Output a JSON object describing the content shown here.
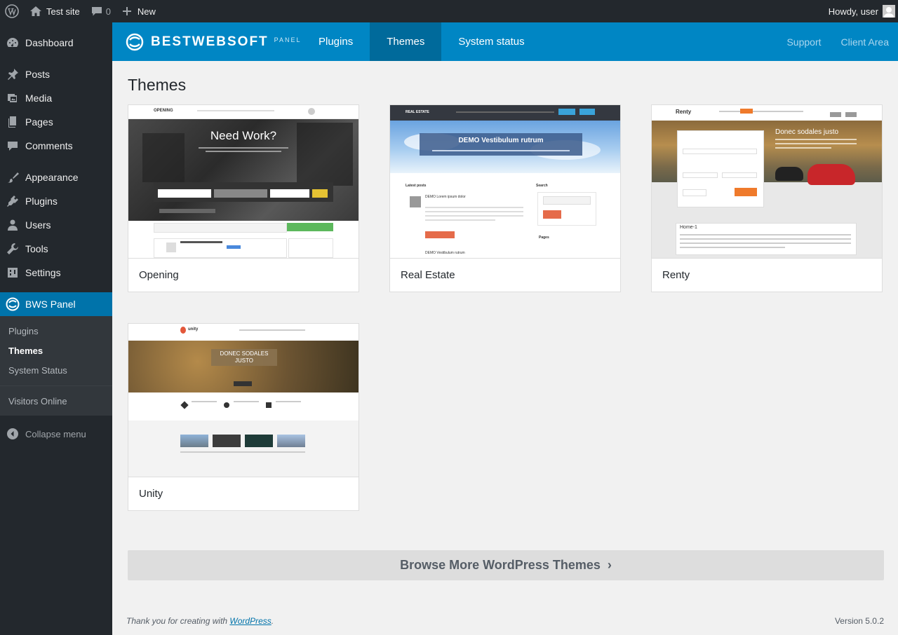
{
  "adminbar": {
    "site_name": "Test site",
    "comments_count": "0",
    "new_label": "New",
    "howdy": "Howdy, user"
  },
  "sidebar": {
    "items": [
      {
        "label": "Dashboard",
        "icon": "dashboard-icon"
      },
      {
        "label": "Posts",
        "icon": "pin-icon"
      },
      {
        "label": "Media",
        "icon": "media-icon"
      },
      {
        "label": "Pages",
        "icon": "pages-icon"
      },
      {
        "label": "Comments",
        "icon": "comments-icon"
      },
      {
        "label": "Appearance",
        "icon": "brush-icon"
      },
      {
        "label": "Plugins",
        "icon": "plugins-icon"
      },
      {
        "label": "Users",
        "icon": "users-icon"
      },
      {
        "label": "Tools",
        "icon": "tools-icon"
      },
      {
        "label": "Settings",
        "icon": "settings-icon"
      },
      {
        "label": "BWS Panel",
        "icon": "bws-icon"
      }
    ],
    "submenu": [
      "Plugins",
      "Themes",
      "System Status",
      "Visitors Online"
    ],
    "collapse": "Collapse menu"
  },
  "bws": {
    "logo": "BESTWEBSOFT",
    "logo_sub": "PANEL",
    "tabs": [
      "Plugins",
      "Themes",
      "System status"
    ],
    "links": [
      "Support",
      "Client Area"
    ]
  },
  "page": {
    "title": "Themes",
    "themes": [
      "Opening",
      "Real Estate",
      "Renty",
      "Unity"
    ],
    "browse": "Browse More WordPress Themes",
    "footer_text": "Thank you for creating with ",
    "footer_link": "WordPress",
    "footer_end": ".",
    "version": "Version 5.0.2"
  },
  "previews": {
    "opening": {
      "headline": "Need Work?",
      "logo": "OPENING"
    },
    "realestate": {
      "headline": "DEMO Vestibulum rutrum",
      "logo": "REAL ESTATE",
      "latest": "Latest posts",
      "search": "Search",
      "post1": "DEMO Lorem ipsum dolor",
      "post2": "DEMO Vestibulum rutrum",
      "pages": "Pages"
    },
    "renty": {
      "headline": "Donec sodales justo",
      "logo": "Renty",
      "section": "Home-1"
    },
    "unity": {
      "headline": "DONEC SODALES JUSTO",
      "logo": "unity"
    }
  },
  "colors": {
    "wp_dark": "#23282d",
    "wp_blue": "#0073aa",
    "bws_blue": "#0086c4",
    "bws_active": "#006a9b"
  }
}
